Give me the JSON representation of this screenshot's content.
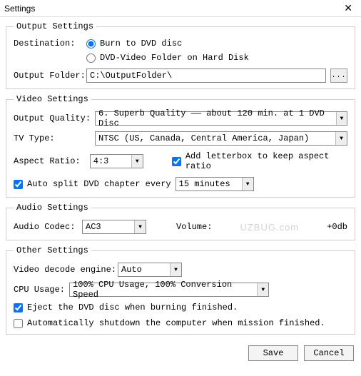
{
  "title": "Settings",
  "output": {
    "legend": "Output Settings",
    "destination_label": "Destination:",
    "radio_burn": "Burn to DVD disc",
    "radio_folder": "DVD-Video Folder on Hard Disk",
    "output_folder_label": "Output Folder:",
    "output_folder_value": "C:\\OutputFolder\\",
    "browse_label": "..."
  },
  "video": {
    "legend": "Video Settings",
    "quality_label": "Output Quality:",
    "quality_value": "6. Superb Quality —— about 120 min. at 1 DVD Disc",
    "tvtype_label": "TV Type:",
    "tvtype_value": "NTSC (US, Canada, Central America, Japan)",
    "aspect_label": "Aspect Ratio:",
    "aspect_value": "4:3",
    "letterbox_label": "Add letterbox to keep aspect ratio",
    "autosplit_label": "Auto split DVD chapter every",
    "autosplit_value": "15 minutes"
  },
  "audio": {
    "legend": "Audio Settings",
    "codec_label": "Audio Codec:",
    "codec_value": "AC3",
    "volume_label": "Volume:",
    "volume_readout": "+0db"
  },
  "other": {
    "legend": "Other Settings",
    "decode_label": "Video decode engine:",
    "decode_value": "Auto",
    "cpu_label": "CPU Usage:",
    "cpu_value": "100% CPU Usage, 100% Conversion Speed",
    "eject_label": "Eject the DVD disc when burning finished.",
    "shutdown_label": "Automatically shutdown the computer when  mission finished."
  },
  "buttons": {
    "save": "Save",
    "cancel": "Cancel"
  },
  "watermark": "UZBUG.com"
}
